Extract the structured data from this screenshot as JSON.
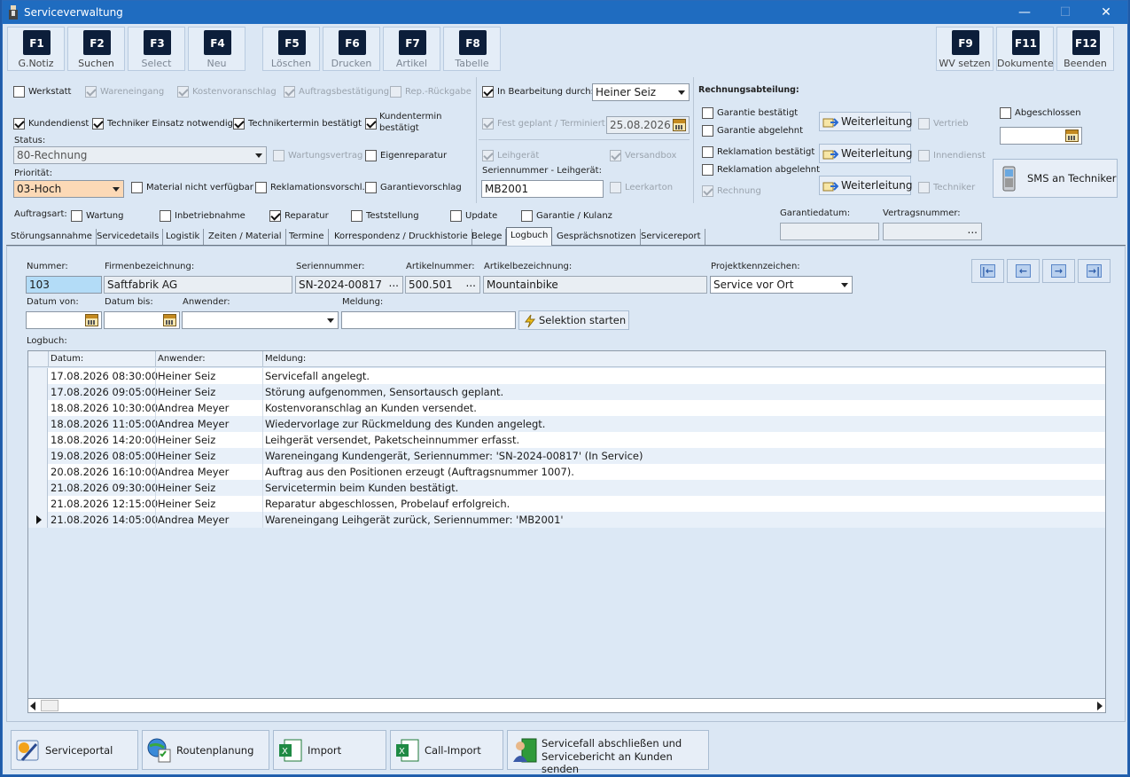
{
  "window": {
    "title": "Serviceverwaltung",
    "min_glyph": "—",
    "max_glyph": "☐",
    "close_glyph": "✕"
  },
  "toolbar": {
    "keys": [
      {
        "key": "F1",
        "label": "G.Notiz"
      },
      {
        "key": "F2",
        "label": "Suchen"
      },
      {
        "key": "F3",
        "label": "Select"
      },
      {
        "key": "F4",
        "label": "Neu"
      },
      {
        "key": "F5",
        "label": "Löschen"
      },
      {
        "key": "F6",
        "label": "Drucken"
      },
      {
        "key": "F7",
        "label": "Artikel"
      },
      {
        "key": "F8",
        "label": "Tabelle"
      },
      {
        "key": "F9",
        "label": "WV setzen"
      },
      {
        "key": "F11",
        "label": "Dokumente"
      },
      {
        "key": "F12",
        "label": "Beenden"
      }
    ]
  },
  "status_flags": {
    "werkstatt": "Werkstatt",
    "wareneingang": "Wareneingang",
    "kostenvoranschlag": "Kostenvoranschlag",
    "auftragsbestaetigung": "Auftragsbestätigung",
    "rep_rueckgabe": "Rep.-Rückgabe",
    "kundendienst": "Kundendienst",
    "techniker_einsatz": "Techniker Einsatz notwendig",
    "technikertermin": "Technikertermin bestätigt",
    "kundentermin_1": "Kundentermin",
    "kundentermin_2": "bestätigt",
    "status_label": "Status:",
    "status_value": "80-Rechnung",
    "wartungsvertrag": "Wartungsvertrag",
    "eigenreparatur": "Eigenreparatur",
    "prioritaet_label": "Priorität:",
    "prioritaet_value": "03-Hoch",
    "material": "Material nicht verfügbar",
    "reklamationsvorschl": "Reklamationsvorschl.",
    "garantievorschlag": "Garantievorschlag"
  },
  "bearbeitung": {
    "in_bearbeitung": "In Bearbeitung durch:",
    "bearbeiter": "Heiner Seiz",
    "fest_geplant": "Fest geplant / Terminiert",
    "termin": "25.08.2026",
    "leihgeraet": "Leihgerät",
    "versandbox": "Versandbox",
    "sn_leih_label": "Seriennummer - Leihgerät:",
    "sn_leih_value": "MB2001",
    "leerkarton": "Leerkarton"
  },
  "rechnung": {
    "title": "Rechnungsabteilung:",
    "garantie_bestaetigt": "Garantie bestätigt",
    "garantie_abgelehnt": "Garantie abgelehnt",
    "reklamation_bestaetigt": "Reklamation bestätigt",
    "reklamation_abgelehnt": "Reklamation abgelehnt",
    "rechnung": "Rechnung",
    "weiterleitung": "Weiterleitung",
    "vertrieb": "Vertrieb",
    "innendienst": "Innendienst",
    "techniker": "Techniker",
    "abgeschlossen": "Abgeschlossen",
    "sms_button": "SMS an Techniker"
  },
  "auftragsart": {
    "label": "Auftragsart:",
    "wartung": "Wartung",
    "inbetriebnahme": "Inbetriebnahme",
    "reparatur": "Reparatur",
    "teststellung": "Teststellung",
    "update": "Update",
    "garantie": "Garantie / Kulanz",
    "garantiedatum_label": "Garantiedatum:",
    "vertragsnummer_label": "Vertragsnummer:",
    "dots": "..."
  },
  "tabs": [
    "Störungsannahme",
    "Servicedetails",
    "Logistik",
    "Zeiten / Material",
    "Termine",
    "Korrespondenz / Druckhistorie",
    "Belege",
    "Logbuch",
    "Gesprächsnotizen",
    "Servicereport"
  ],
  "filter": {
    "nummer_label": "Nummer:",
    "nummer": "103",
    "firma_label": "Firmenbezeichnung:",
    "firma": "Saftfabrik AG",
    "sn_label": "Seriennummer:",
    "sn": "SN-2024-00817",
    "artnr_label": "Artikelnummer:",
    "artnr": "500.501",
    "artbez_label": "Artikelbezeichnung:",
    "artbez": "Mountainbike",
    "projekt_label": "Projektkennzeichen:",
    "projekt": "Service vor Ort",
    "datum_von_label": "Datum von:",
    "datum_bis_label": "Datum bis:",
    "anwender_label": "Anwender:",
    "meldung_label": "Meldung:",
    "selektion_button": "Selektion starten",
    "dots": "...",
    "nav_first": "|←",
    "nav_prev": "←",
    "nav_next": "→",
    "nav_last": "→|"
  },
  "logbuch": {
    "label": "Logbuch:",
    "columns": [
      "Datum:",
      "Anwender:",
      "Meldung:"
    ],
    "rows": [
      [
        "17.08.2026 08:30:00",
        "Heiner Seiz",
        "Servicefall angelegt."
      ],
      [
        "17.08.2026 09:05:00",
        "Heiner Seiz",
        "Störung aufgenommen, Sensortausch geplant."
      ],
      [
        "18.08.2026 10:30:00",
        "Andrea Meyer",
        "Kostenvoranschlag an Kunden versendet."
      ],
      [
        "18.08.2026 11:05:00",
        "Andrea Meyer",
        "Wiedervorlage zur Rückmeldung des Kunden angelegt."
      ],
      [
        "18.08.2026 14:20:00",
        "Heiner Seiz",
        "Leihgerät versendet, Paketscheinnummer erfasst."
      ],
      [
        "19.08.2026 08:05:00",
        "Heiner Seiz",
        "Wareneingang Kundengerät, Seriennummer: 'SN-2024-00817' (In Service)"
      ],
      [
        "20.08.2026 16:10:00",
        "Andrea Meyer",
        "Auftrag aus den Positionen erzeugt (Auftragsnummer 1007)."
      ],
      [
        "21.08.2026 09:30:00",
        "Heiner Seiz",
        "Servicetermin beim Kunden bestätigt."
      ],
      [
        "21.08.2026 12:15:00",
        "Heiner Seiz",
        "Reparatur abgeschlossen, Probelauf erfolgreich."
      ],
      [
        "21.08.2026 14:05:00",
        "Andrea Meyer",
        "Wareneingang Leihgerät zurück, Seriennummer: 'MB2001'"
      ]
    ],
    "selected_row": 9
  },
  "bottom": {
    "serviceportal": "Serviceportal",
    "routenplanung": "Routenplanung",
    "import": "Import",
    "call_import": "Call-Import",
    "abschliessen_1": "Servicefall abschließen und",
    "abschliessen_2": "Servicebericht an Kunden senden"
  },
  "colors": {
    "title_bar": "#1f6cc0",
    "priority_bg": "#fcd9b6",
    "nummer_bg": "#b3dcf7",
    "fkey_cap": "#0c1e3a"
  }
}
